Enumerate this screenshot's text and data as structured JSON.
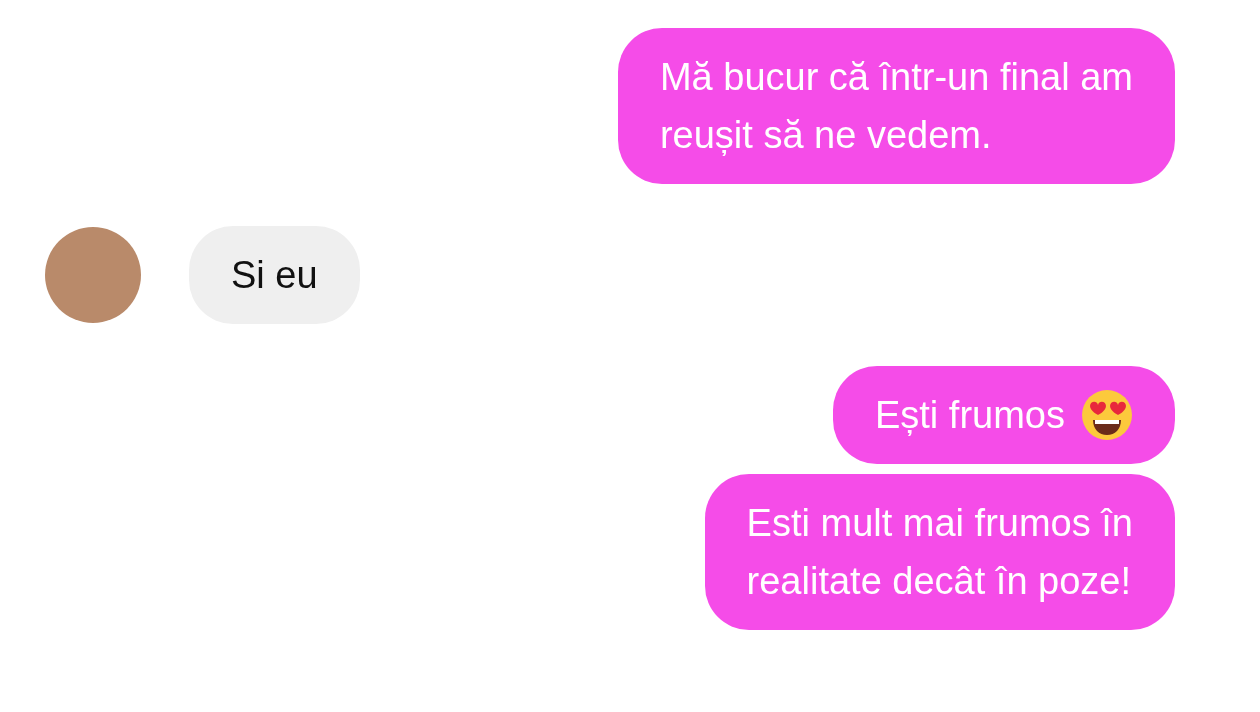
{
  "messages": [
    {
      "kind": "sent",
      "lines": [
        "Mă bucur că într-un final am",
        "reușit să ne vedem."
      ]
    },
    {
      "kind": "received",
      "lines": [
        "Si eu"
      ]
    },
    {
      "kind": "sent",
      "lines": [
        "Ești frumos"
      ],
      "emoji_after": true
    },
    {
      "kind": "sent",
      "lines": [
        "Esti mult mai frumos în",
        "realitate decât în poze!"
      ]
    }
  ]
}
